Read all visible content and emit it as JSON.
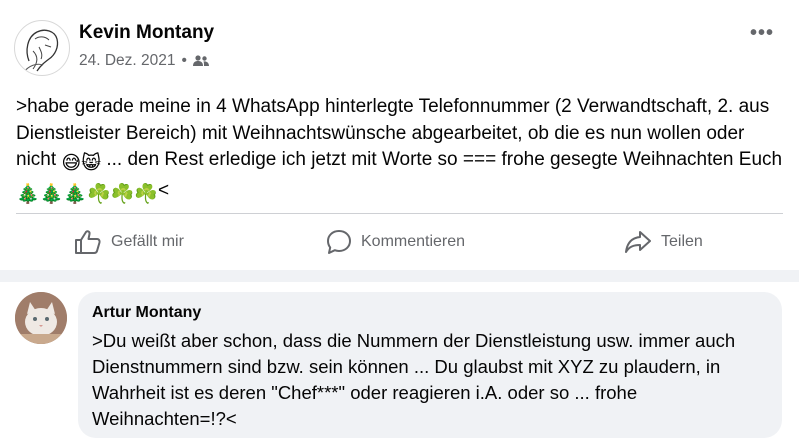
{
  "post": {
    "author": "Kevin Montany",
    "date": "24. Dez. 2021",
    "separator": "•",
    "audience_icon": "friends-icon",
    "more_icon": "•••",
    "text_parts": [
      ">habe gerade meine in 4 WhatsApp hinterlegte Telefonnummer (2 Verwandtschaft, 2. aus Dienstleister Bereich)  mit Weihnachtswünsche abgearbeitet, ob die es nun wollen oder nicht ",
      "😅😸",
      " ... den Rest erledige ich jetzt mit Worte  so === frohe gesegte Weihnachten Euch ",
      "🎄🎄🎄☘️☘️☘️",
      "<"
    ]
  },
  "actions": {
    "like": "Gefällt mir",
    "comment": "Kommentieren",
    "share": "Teilen"
  },
  "comment": {
    "author": "Artur Montany",
    "text": ">Du weißt aber schon, dass die Nummern der Dienstleistung usw. immer auch Dienstnummern sind bzw. sein können ... Du glaubst mit XYZ zu plaudern, in Wahrheit ist es deren \"Chef***\" oder reagieren i.A. oder so ... frohe Weihnachten=!?<"
  },
  "colors": {
    "secondary_text": "#65676b",
    "divider": "#ced0d4",
    "bubble": "#f0f2f5"
  }
}
